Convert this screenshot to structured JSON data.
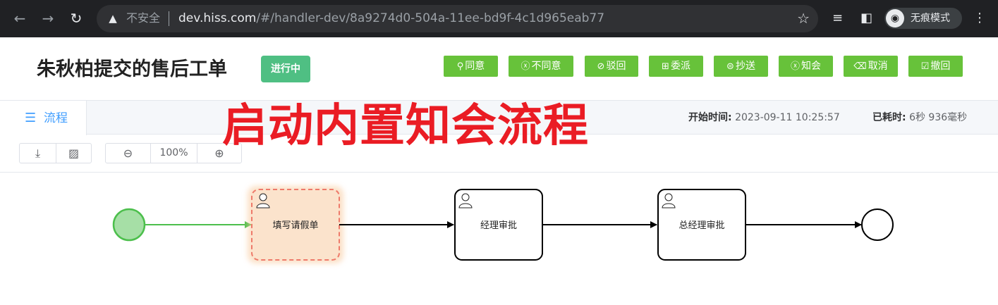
{
  "browser": {
    "insecure_label": "不安全",
    "url_host": "dev.hiss.com",
    "url_path": "/#/handler-dev/8a9274d0-504a-11ee-bd9f-4c1d965eab77",
    "incognito_label": "无痕模式"
  },
  "header": {
    "title": "朱秋柏提交的售后工单",
    "status": "进行中",
    "actions": [
      {
        "label": "同意",
        "icon": "stamp-icon"
      },
      {
        "label": "不同意",
        "icon": "x-circle-icon"
      },
      {
        "label": "驳回",
        "icon": "eye-off-icon"
      },
      {
        "label": "委派",
        "icon": "grid-icon"
      },
      {
        "label": "抄送",
        "icon": "copy-circle-icon"
      },
      {
        "label": "知会",
        "icon": "x-circle-icon"
      },
      {
        "label": "取消",
        "icon": "backspace-icon"
      },
      {
        "label": "撤回",
        "icon": "edit-box-icon"
      }
    ],
    "colors": {
      "action": "#67c23a",
      "status": "#4fbf83"
    }
  },
  "tabs": {
    "active_label": "流程",
    "start_time_label": "开始时间:",
    "start_time_value": "2023-09-11 10:25:57",
    "elapsed_label": "已耗时:",
    "elapsed_value": "6秒 936毫秒"
  },
  "annotation": {
    "text": "启动内置知会流程",
    "color": "#ea1c24"
  },
  "toolbar": {
    "zoom": "100%"
  },
  "diagram": {
    "tasks": [
      {
        "label": "填写请假单",
        "state": "active"
      },
      {
        "label": "经理审批",
        "state": "pending"
      },
      {
        "label": "总经理审批",
        "state": "pending"
      }
    ]
  }
}
